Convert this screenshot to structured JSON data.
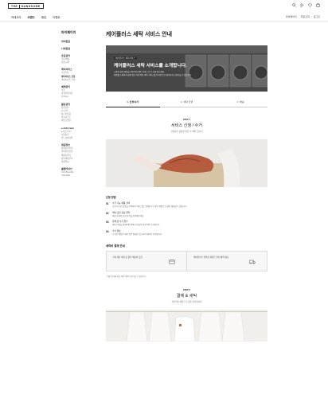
{
  "header": {
    "logo_left": "THE",
    "logo_right": "HANDSOME",
    "icons": [
      "search-icon",
      "history-icon",
      "wishlist-icon",
      "cart-icon"
    ]
  },
  "gnb": {
    "items": [
      "카테고리",
      "브랜드",
      "랭킹",
      "이벤트"
    ],
    "right": [
      "마이페이지",
      "주문조회",
      "로그인"
    ]
  },
  "lnb": {
    "title": "마이페이지",
    "groups": [
      {
        "title": "마이한섬",
        "items": []
      },
      {
        "title": "나의한섬",
        "items": []
      },
      {
        "title": "주문관리",
        "items": [
          "주문/배송",
          "반품/교환"
        ]
      },
      {
        "title": "케어서비스",
        "items": [
          "수선신청",
          "세탁서비스 신청",
          "케어서비스 조회"
        ]
      },
      {
        "title": "혜택관리",
        "items": [
          "쿠폰",
          "한섬마일리지",
          "H.Point"
        ]
      },
      {
        "title": "활동관리",
        "items": [
          "상품리뷰",
          "1:1문의",
          "최근본상품",
          "위시리스트",
          "재입고알림"
        ]
      },
      {
        "title": "e-Gift Card",
        "items": [
          "e기프트카드",
          "선물하기",
          "카드사용내역"
        ]
      },
      {
        "title": "회원정보",
        "items": [
          "회원정보변경",
          "비밀번호변경",
          "배송지관리",
          "환불계좌관리",
          "회원탈퇴"
        ]
      },
      {
        "title": "클럽라이브",
        "items": [
          "Club Benefits",
          "Club Mall"
        ]
      }
    ]
  },
  "main": {
    "title": "케어플러스 세탁 서비스 안내",
    "hero": {
      "small": "케어플러스 세탁서비스",
      "big": "케어플러스 세탁 서비스를 소개합니다.",
      "desc1": "소중한 한섬 제품을 전문적인 세탁 서비스로 더 오래 입으세요.",
      "desc2": "제품별 소재와 특성에 맞춘 전문적인 세탁 서비스를 온라인으로 편리하게 신청하실 수 있습니다."
    },
    "steps": [
      "1. 신청/수거",
      "2. 세탁 진행",
      "3. 배송"
    ],
    "step1": {
      "badge": "STEP 1",
      "title": "서비스 신청 / 수거",
      "sub": "신청하신 상품을 방문 수거해드립니다"
    },
    "apply_heading": "신청 방법",
    "apply_rows": [
      {
        "num": "01",
        "t1": "수거 가능 제품 선택",
        "t2": "신청 가능한 상품을 선택하여 서비스를 신청합니다. 일부 제품은 신청이 제한될 수 있습니다."
      },
      {
        "num": "02",
        "t1": "세탁 요청 정보 입력",
        "t2": "제품 상태와 요청 사항을 입력해주세요."
      },
      {
        "num": "03",
        "t1": "결제 및 수거 접수",
        "t2": "세탁 비용을 결제하면 택배 기사님이 방문하여 수거합니다."
      },
      {
        "num": "04",
        "t1": "수거 완료",
        "t2": "수거된 제품은 세탁 전문 업체로 입고되어 세탁이 진행됩니다."
      }
    ],
    "price_heading": "세탁비 결제 안내",
    "price_boxes": [
      "1벌 세탁 비용 및 왕복 배송비 포함",
      "케어플러스 멤버십 회원은 할인 혜택 제공"
    ],
    "note": "* 제품 특성에 따라 세탁 비용이 상이할 수 있습니다.",
    "step2": {
      "badge": "STEP 2",
      "title": "결제 & 세탁",
      "sub": "전문적인 세탁으로 옷을 관리합니다"
    }
  }
}
